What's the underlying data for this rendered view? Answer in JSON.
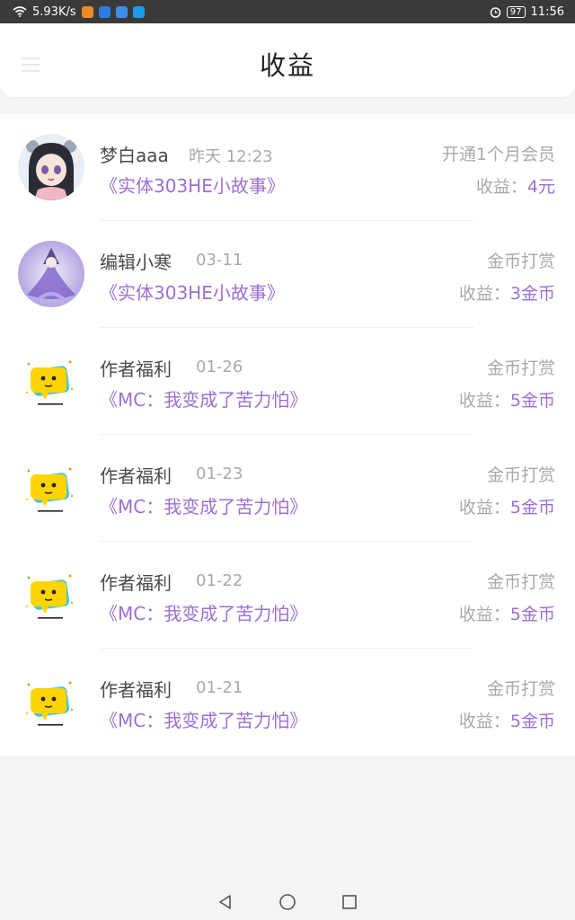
{
  "status_bar": {
    "speed": "5.93K/s",
    "battery": "97",
    "time": "11:56"
  },
  "header": {
    "title": "收益"
  },
  "colors": {
    "accent": "#9b6fd3",
    "muted": "#a9a9a9"
  },
  "list": [
    {
      "name": "梦白aaa",
      "date": "昨天 12:23",
      "book": "《实体303HE小故事》",
      "type": "开通1个月会员",
      "income_label": "收益：",
      "income_value": "4元",
      "avatar": "girl-avatar"
    },
    {
      "name": "编辑小寒",
      "date": "03-11",
      "book": "《实体303HE小故事》",
      "type": "金币打赏",
      "income_label": "收益：",
      "income_value": "3金币",
      "avatar": "anime-purple-avatar"
    },
    {
      "name": "作者福利",
      "date": "01-26",
      "book": "《MC：我变成了苦力怕》",
      "type": "金币打赏",
      "income_label": "收益：",
      "income_value": "5金币",
      "avatar": "chat-bubble-avatar"
    },
    {
      "name": "作者福利",
      "date": "01-23",
      "book": "《MC：我变成了苦力怕》",
      "type": "金币打赏",
      "income_label": "收益：",
      "income_value": "5金币",
      "avatar": "chat-bubble-avatar"
    },
    {
      "name": "作者福利",
      "date": "01-22",
      "book": "《MC：我变成了苦力怕》",
      "type": "金币打赏",
      "income_label": "收益：",
      "income_value": "5金币",
      "avatar": "chat-bubble-avatar"
    },
    {
      "name": "作者福利",
      "date": "01-21",
      "book": "《MC：我变成了苦力怕》",
      "type": "金币打赏",
      "income_label": "收益：",
      "income_value": "5金币",
      "avatar": "chat-bubble-avatar"
    }
  ]
}
